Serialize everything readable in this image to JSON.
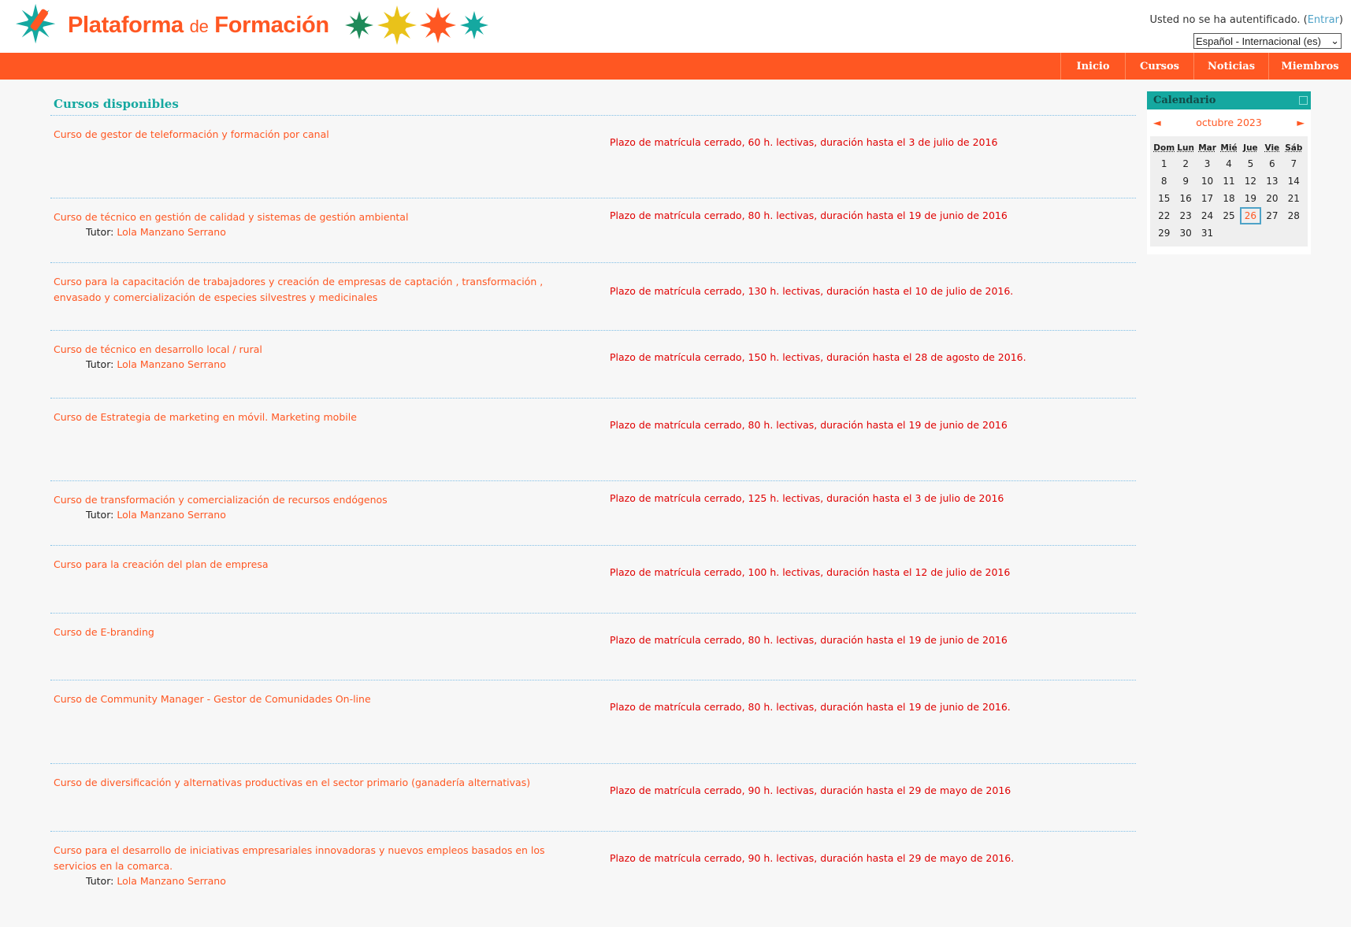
{
  "header": {
    "logo_text": "Plataforma",
    "logo_text_de": "de",
    "logo_text_2": "Formación",
    "auth_text": "Usted no se ha autentificado. (",
    "auth_link": "Entrar",
    "auth_close": ")",
    "language": "Español - Internacional (es)"
  },
  "nav": {
    "items": [
      {
        "label": "Inicio"
      },
      {
        "label": "Cursos"
      },
      {
        "label": "Noticias"
      },
      {
        "label": "Miembros"
      }
    ]
  },
  "main": {
    "title": "Cursos disponibles",
    "courses": [
      {
        "title": "Curso de gestor de teleformación y formación por canal",
        "tutor": "",
        "info": "Plazo de matrícula cerrado, 60 h. lectivas, duración hasta el 3 de julio de 2016"
      },
      {
        "title": "Curso de técnico en gestión de calidad y sistemas de gestión ambiental",
        "tutor": "Lola Manzano Serrano",
        "info": "Plazo de matrícula cerrado, 80 h. lectivas, duración hasta el 19 de junio de 2016"
      },
      {
        "title": "Curso para la capacitación de trabajadores y creación de empresas de captación , transformación , envasado y comercialización de especies silvestres y medicinales",
        "tutor": "",
        "info": "Plazo de matrícula cerrado, 130 h. lectivas, duración hasta el 10 de julio de 2016."
      },
      {
        "title": "Curso de técnico en desarrollo local / rural",
        "tutor": "Lola Manzano Serrano",
        "info": "Plazo de matrícula cerrado, 150 h. lectivas, duración hasta el 28 de agosto de 2016."
      },
      {
        "title": "Curso de Estrategia de marketing en móvil. Marketing mobile",
        "tutor": "",
        "info": "Plazo de matrícula cerrado, 80 h. lectivas, duración hasta el 19 de junio de 2016"
      },
      {
        "title": "Curso de transformación y comercialización de recursos endógenos",
        "tutor": "Lola Manzano Serrano",
        "info": "Plazo de matrícula cerrado, 125 h. lectivas, duración hasta el 3 de julio de 2016"
      },
      {
        "title": "Curso para la creación del plan de empresa",
        "tutor": "",
        "info": "Plazo de matrícula cerrado, 100 h. lectivas, duración hasta el 12 de julio de 2016"
      },
      {
        "title": "Curso de E-branding",
        "tutor": "",
        "info": "Plazo de matrícula cerrado, 80 h. lectivas, duración hasta el 19 de junio de 2016"
      },
      {
        "title": "Curso de Community Manager - Gestor de Comunidades On-line",
        "tutor": "",
        "info": "Plazo de matrícula cerrado, 80 h. lectivas, duración hasta el 19 de junio de 2016."
      },
      {
        "title": "Curso de diversificación y alternativas productivas en el sector primario (ganadería alternativas)",
        "tutor": "",
        "info": "Plazo de matrícula cerrado, 90 h. lectivas, duración hasta el 29 de mayo de 2016"
      },
      {
        "title": "Curso para el desarrollo de iniciativas empresariales innovadoras y nuevos empleos basados en los servicios en la comarca.",
        "tutor": "Lola Manzano Serrano",
        "info": "Plazo de matrícula cerrado, 90 h. lectivas, duración hasta el 29 de mayo de 2016."
      }
    ],
    "tutor_label": "Tutor:"
  },
  "calendar": {
    "title": "Calendario",
    "month": "octubre 2023",
    "prev": "◄",
    "next": "►",
    "day_names": [
      "Dom",
      "Lun",
      "Mar",
      "Mié",
      "Jue",
      "Vie",
      "Sáb"
    ],
    "weeks": [
      [
        "1",
        "2",
        "3",
        "4",
        "5",
        "6",
        "7"
      ],
      [
        "8",
        "9",
        "10",
        "11",
        "12",
        "13",
        "14"
      ],
      [
        "15",
        "16",
        "17",
        "18",
        "19",
        "20",
        "21"
      ],
      [
        "22",
        "23",
        "24",
        "25",
        "26",
        "27",
        "28"
      ],
      [
        "29",
        "30",
        "31",
        "",
        "",
        "",
        ""
      ]
    ],
    "today": "26"
  },
  "colors": {
    "brand": "#ff5722",
    "teal": "#15a8a0",
    "info_red": "#e00000",
    "link_blue": "#4fa3c8"
  }
}
